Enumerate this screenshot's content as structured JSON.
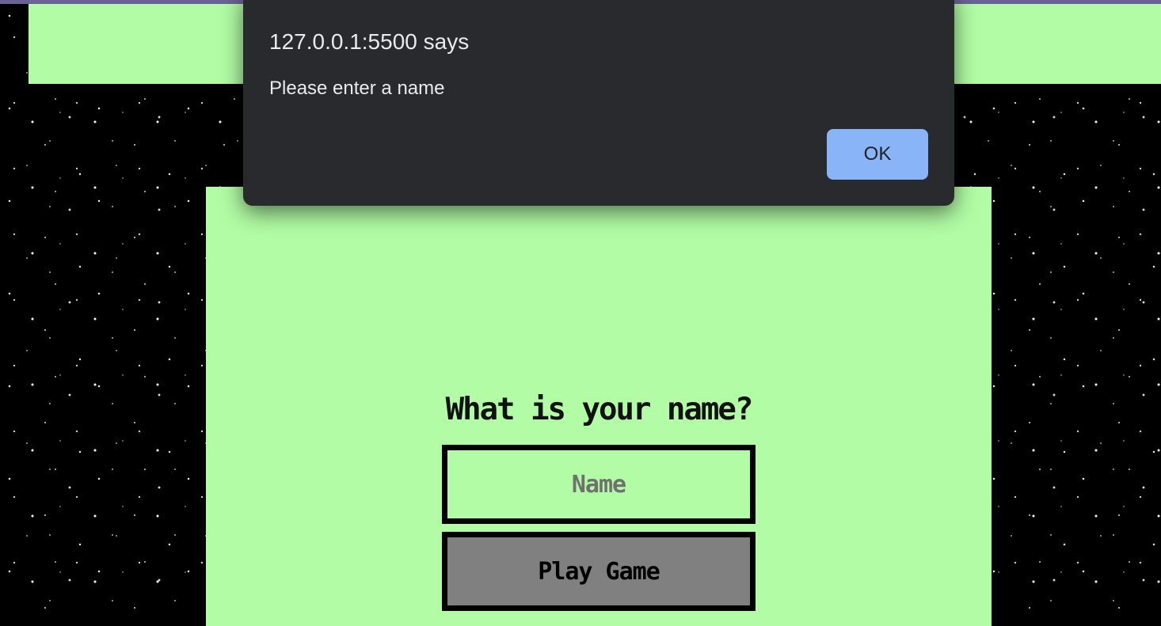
{
  "alert": {
    "title": "127.0.0.1:5500 says",
    "message": "Please enter a name",
    "ok_label": "OK"
  },
  "form": {
    "heading": "What is your name?",
    "name_placeholder": "Name",
    "name_value": "",
    "play_label": "Play Game"
  },
  "colors": {
    "panel_green": "#b1fca4",
    "play_button_gray": "#808080",
    "dialog_background": "#292a2d",
    "ok_button_blue": "#8ab4f8",
    "top_strip_purple": "#6a6296",
    "background": "#000000"
  }
}
